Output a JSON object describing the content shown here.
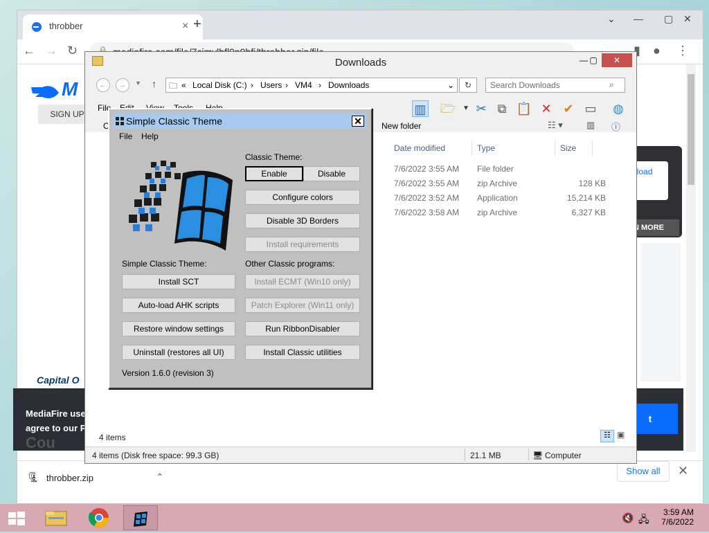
{
  "chrome": {
    "tab_title": "throbber",
    "url": "mediafire.com/file/7cimylbfl0p9bfi/throbber.zip/file"
  },
  "page": {
    "logo_text": "M",
    "signup": "SIGN UP",
    "download_btn": "nload",
    "more_btn": "N MORE",
    "capital_text": "Capital O",
    "consent_line1": "MediaFire use",
    "consent_line2": "agree to our P",
    "consent_line3": "Cou",
    "consent_btn": "t"
  },
  "download_bar": {
    "file_name": "throbber.zip",
    "show_all": "Show all"
  },
  "explorer": {
    "title": "Downloads",
    "breadcrumb": [
      "Local Disk (C:)",
      "Users",
      "VM4",
      "Downloads"
    ],
    "search_placeholder": "Search Downloads",
    "menu": [
      "File",
      "Edit",
      "View",
      "Tools",
      "Help"
    ],
    "new_folder": "New folder",
    "columns": [
      "Date modified",
      "Type",
      "Size"
    ],
    "partial_col": "O",
    "rows": [
      {
        "date": "7/6/2022 3:55 AM",
        "type": "File folder",
        "size": ""
      },
      {
        "date": "7/6/2022 3:55 AM",
        "type": "zip Archive",
        "size": "128 KB"
      },
      {
        "date": "7/6/2022 3:52 AM",
        "type": "Application",
        "size": "15,214 KB"
      },
      {
        "date": "7/6/2022 3:58 AM",
        "type": "zip Archive",
        "size": "6,327 KB"
      }
    ],
    "item_count": "4 items",
    "status_left": "4 items (Disk free space: 99.3 GB)",
    "status_size": "21.1 MB",
    "status_computer": "Computer"
  },
  "sct": {
    "title": "Simple Classic Theme",
    "menu": [
      "File",
      "Help"
    ],
    "classic_theme_label": "Classic Theme:",
    "enable": "Enable",
    "disable": "Disable",
    "configure_colors": "Configure colors",
    "disable_3d": "Disable 3D Borders",
    "install_req": "Install requirements",
    "sct_label": "Simple Classic Theme:",
    "other_label": "Other Classic programs:",
    "install_sct": "Install SCT",
    "install_ecmt": "Install ECMT (Win10 only)",
    "autoload": "Auto-load AHK scripts",
    "patch_explorer": "Patch Explorer (Win11 only)",
    "restore": "Restore window settings",
    "ribbon": "Run RibbonDisabler",
    "uninstall": "Uninstall (restores all UI)",
    "classic_utils": "Install Classic utilities",
    "version": "Version 1.6.0 (revision 3)"
  },
  "taskbar": {
    "time": "3:59 AM",
    "date": "7/6/2022"
  },
  "colors": {
    "taskbar": "#d8a8b3",
    "sct_title": "#a6caf0",
    "mediafire_blue": "#0a6bff"
  }
}
